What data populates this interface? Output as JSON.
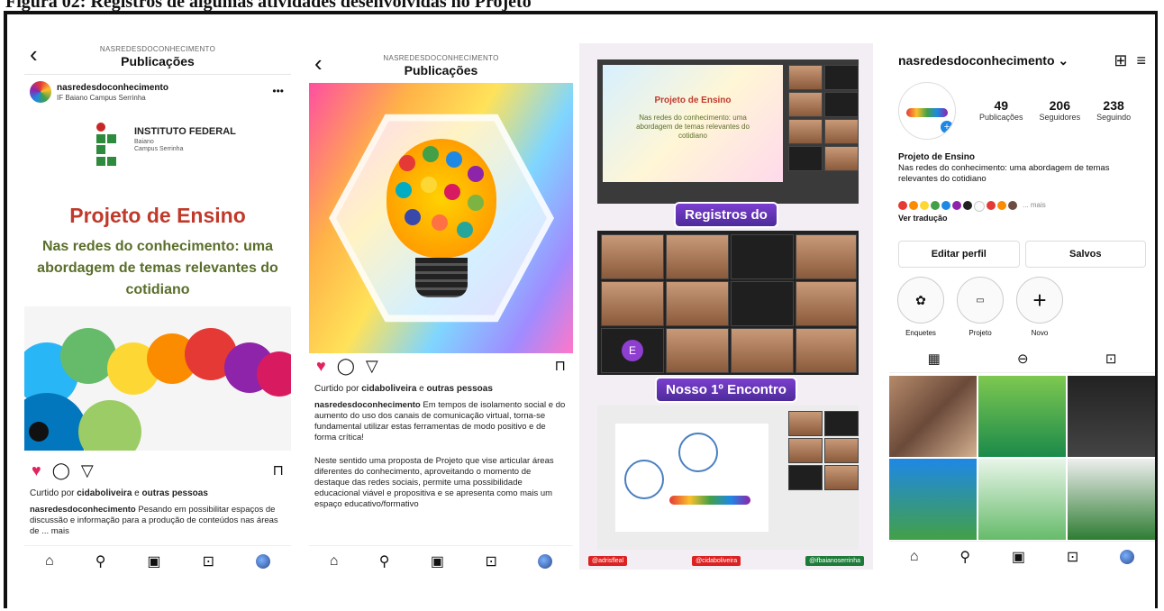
{
  "figure_caption": "Figura 02: Registros de algumas atividades desenvolvidas no Projeto",
  "panel1": {
    "account_small": "NASREDESDOCONHECIMENTO",
    "title": "Publicações",
    "username": "nasredesdoconhecimento",
    "location": "IF Baiano Campus Serrinha",
    "logo_name": "INSTITUTO FEDERAL",
    "logo_sub1": "Baiano",
    "logo_sub2": "Campus Serrinha",
    "heading": "Projeto de Ensino",
    "subheading": "Nas redes do conhecimento: uma abordagem de temas relevantes do cotidiano",
    "liked_prefix": "Curtido por ",
    "liked_user": "cidaboliveira",
    "liked_mid": " e ",
    "liked_rest": "outras pessoas",
    "caption_user": "nasredesdoconhecimento",
    "caption_text": "Pesando em possibilitar espaços de discussão e informação para a produção de conteúdos nas áreas de ... mais"
  },
  "panel2": {
    "account_small": "NASREDESDOCONHECIMENTO",
    "title": "Publicações",
    "liked_prefix": "Curtido por ",
    "liked_user": "cidaboliveira",
    "liked_mid": " e ",
    "liked_rest": "outras pessoas",
    "caption_user": "nasredesdoconhecimento",
    "caption_text": "Em tempos de isolamento social e do aumento do uso dos canais de comunicação virtual, torna-se fundamental utilizar estas ferramentas de modo positivo e de forma crítica!",
    "caption_text2": "Neste sentido uma proposta de Projeto que vise articular áreas diferentes do conhecimento, aproveitando o momento de destaque das redes sociais, permite uma possibilidade educacional viável e propositiva e se apresenta como mais um espaço educativo/formativo"
  },
  "panel3": {
    "slide_title": "Projeto de Ensino",
    "slide_text": "Nas redes do conhecimento: uma abordagem de temas relevantes do cotidiano",
    "banner1": "Registros do",
    "banner2": "Nosso 1º Encontro",
    "avatar_letter": "E",
    "tag1": "@adrisfleal",
    "tag2": "@cidaboliveira",
    "tag3": "@ifbaianoserrinha"
  },
  "panel4": {
    "username": "nasredesdoconhecimento",
    "posts_n": "49",
    "posts_l": "Publicações",
    "followers_n": "206",
    "followers_l": "Seguidores",
    "following_n": "238",
    "following_l": "Seguindo",
    "bio_title": "Projeto de Ensino",
    "bio_text": "Nas redes do conhecimento: uma abordagem de temas relevantes do cotidiano",
    "more": "... mais",
    "translate": "Ver tradução",
    "edit_profile": "Editar perfil",
    "saved": "Salvos",
    "hl1": "Enquetes",
    "hl2": "Projeto",
    "hl3": "Novo"
  },
  "colors": {
    "accent_red": "#c0392b",
    "heart": "#e0245e",
    "olive": "#5a6e2a"
  }
}
